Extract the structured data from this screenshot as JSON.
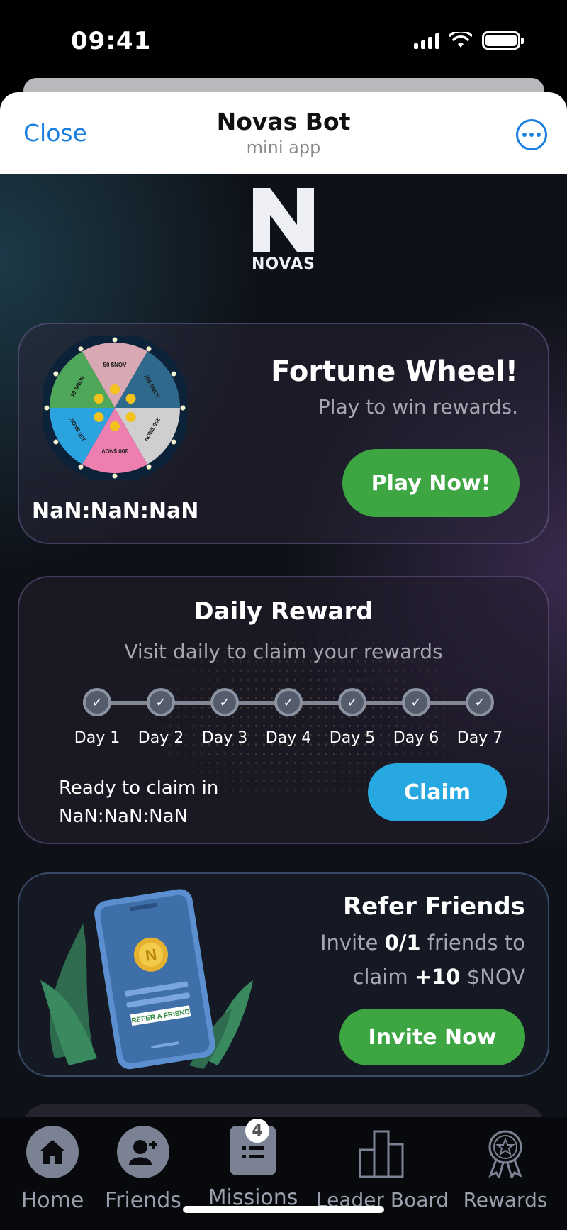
{
  "status": {
    "time": "09:41"
  },
  "header": {
    "close_label": "Close",
    "title": "Novas Bot",
    "subtitle": "mini app"
  },
  "brand": {
    "logo_text": "NOVAS",
    "accent": "#3da542",
    "claim_color": "#27a8e0"
  },
  "wheel_card": {
    "title": "Fortune Wheel!",
    "subtitle": "Play to win rewards.",
    "button": "Play Now!",
    "timer": "NaN:NaN:NaN",
    "segments": [
      "50 $NOV",
      "100 $NOV",
      "200 $NOV",
      "300 $NOV",
      "150 $NOV",
      "10 $NOV"
    ]
  },
  "daily_card": {
    "title": "Daily Reward",
    "subtitle": "Visit daily to claim your rewards",
    "days": [
      "Day 1",
      "Day 2",
      "Day 3",
      "Day 4",
      "Day 5",
      "Day 6",
      "Day 7"
    ],
    "ready_label": "Ready to claim in",
    "ready_timer": "NaN:NaN:NaN",
    "button": "Claim"
  },
  "refer_card": {
    "title": "Refer Friends",
    "line1_pre": "Invite ",
    "line1_count": "0/1",
    "line1_post": " friends to",
    "line2_pre": "claim ",
    "line2_amount": "+10",
    "line2_post": " $NOV",
    "art_label": "REFER A FRIEND",
    "button": "Invite Now"
  },
  "nav": {
    "items": [
      {
        "label": "Home",
        "icon": "home-icon"
      },
      {
        "label": "Friends",
        "icon": "add-friend-icon"
      },
      {
        "label": "Missions",
        "icon": "missions-icon",
        "badge": "4"
      },
      {
        "label": "Leader Board",
        "icon": "leaderboard-icon"
      },
      {
        "label": "Rewards",
        "icon": "rewards-icon"
      }
    ]
  }
}
